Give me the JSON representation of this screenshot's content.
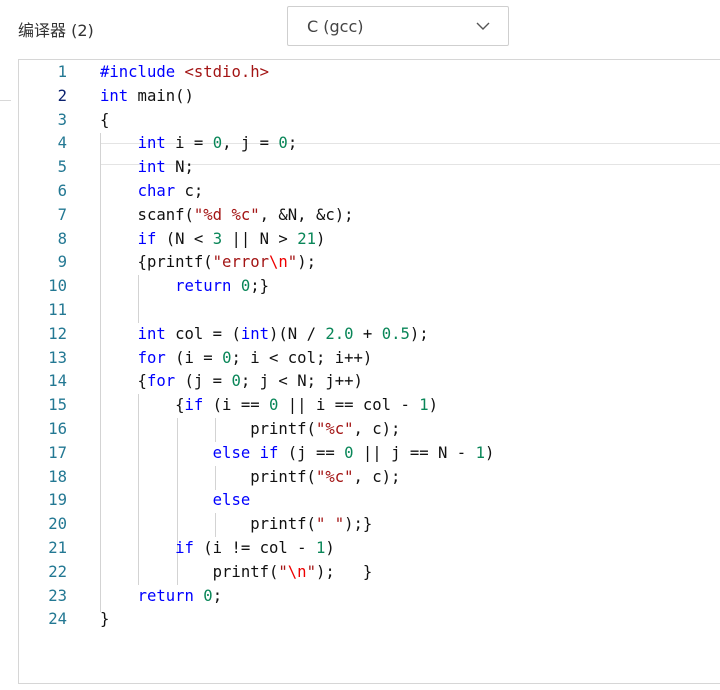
{
  "header": {
    "compiler_label": "编译器 (2)",
    "compiler_select": {
      "value": "C (gcc)"
    }
  },
  "icons": {
    "dropdown": "chevron-down-icon"
  },
  "colors": {
    "keyword": "#0000ff",
    "string": "#a31515",
    "number": "#098658",
    "escape": "#ee0000",
    "line_number": "#237893"
  },
  "editor": {
    "active_line": 2,
    "lines": [
      {
        "n": "1",
        "tokens": [
          {
            "t": "#include ",
            "c": "k"
          },
          {
            "t": "<stdio.h>",
            "c": "s"
          }
        ]
      },
      {
        "n": "2",
        "tokens": [
          {
            "t": "int",
            "c": "k"
          },
          {
            "t": " main()",
            "c": ""
          }
        ]
      },
      {
        "n": "3",
        "tokens": [
          {
            "t": "{",
            "c": ""
          }
        ]
      },
      {
        "n": "4",
        "tokens": [
          {
            "t": "    ",
            "c": ""
          },
          {
            "t": "int",
            "c": "k"
          },
          {
            "t": " i = ",
            "c": ""
          },
          {
            "t": "0",
            "c": "n"
          },
          {
            "t": ", j = ",
            "c": ""
          },
          {
            "t": "0",
            "c": "n"
          },
          {
            "t": ";",
            "c": ""
          }
        ]
      },
      {
        "n": "5",
        "tokens": [
          {
            "t": "    ",
            "c": ""
          },
          {
            "t": "int",
            "c": "k"
          },
          {
            "t": " N;",
            "c": ""
          }
        ]
      },
      {
        "n": "6",
        "tokens": [
          {
            "t": "    ",
            "c": ""
          },
          {
            "t": "char",
            "c": "k"
          },
          {
            "t": " c;",
            "c": ""
          }
        ]
      },
      {
        "n": "7",
        "tokens": [
          {
            "t": "    scanf(",
            "c": ""
          },
          {
            "t": "\"%d %c\"",
            "c": "s"
          },
          {
            "t": ", &N, &c);",
            "c": ""
          }
        ]
      },
      {
        "n": "8",
        "tokens": [
          {
            "t": "    ",
            "c": ""
          },
          {
            "t": "if",
            "c": "k"
          },
          {
            "t": " (N < ",
            "c": ""
          },
          {
            "t": "3",
            "c": "n"
          },
          {
            "t": " || N > ",
            "c": ""
          },
          {
            "t": "21",
            "c": "n"
          },
          {
            "t": ")",
            "c": ""
          }
        ]
      },
      {
        "n": "9",
        "tokens": [
          {
            "t": "    {printf(",
            "c": ""
          },
          {
            "t": "\"error",
            "c": "s"
          },
          {
            "t": "\\n",
            "c": "e"
          },
          {
            "t": "\"",
            "c": "s"
          },
          {
            "t": ");",
            "c": ""
          }
        ]
      },
      {
        "n": "10",
        "tokens": [
          {
            "t": "        ",
            "c": ""
          },
          {
            "t": "return",
            "c": "k"
          },
          {
            "t": " ",
            "c": ""
          },
          {
            "t": "0",
            "c": "n"
          },
          {
            "t": ";}",
            "c": ""
          }
        ]
      },
      {
        "n": "11",
        "tokens": []
      },
      {
        "n": "12",
        "tokens": [
          {
            "t": "    ",
            "c": ""
          },
          {
            "t": "int",
            "c": "k"
          },
          {
            "t": " col = (",
            "c": ""
          },
          {
            "t": "int",
            "c": "k"
          },
          {
            "t": ")(N / ",
            "c": ""
          },
          {
            "t": "2.0",
            "c": "n"
          },
          {
            "t": " + ",
            "c": ""
          },
          {
            "t": "0.5",
            "c": "n"
          },
          {
            "t": ");",
            "c": ""
          }
        ]
      },
      {
        "n": "13",
        "tokens": [
          {
            "t": "    ",
            "c": ""
          },
          {
            "t": "for",
            "c": "k"
          },
          {
            "t": " (i = ",
            "c": ""
          },
          {
            "t": "0",
            "c": "n"
          },
          {
            "t": "; i < col; i++)",
            "c": ""
          }
        ]
      },
      {
        "n": "14",
        "tokens": [
          {
            "t": "    {",
            "c": ""
          },
          {
            "t": "for",
            "c": "k"
          },
          {
            "t": " (j = ",
            "c": ""
          },
          {
            "t": "0",
            "c": "n"
          },
          {
            "t": "; j < N; j++)",
            "c": ""
          }
        ]
      },
      {
        "n": "15",
        "tokens": [
          {
            "t": "        {",
            "c": ""
          },
          {
            "t": "if",
            "c": "k"
          },
          {
            "t": " (i == ",
            "c": ""
          },
          {
            "t": "0",
            "c": "n"
          },
          {
            "t": " || i == col - ",
            "c": ""
          },
          {
            "t": "1",
            "c": "n"
          },
          {
            "t": ")",
            "c": ""
          }
        ]
      },
      {
        "n": "16",
        "tokens": [
          {
            "t": "                printf(",
            "c": ""
          },
          {
            "t": "\"%c\"",
            "c": "s"
          },
          {
            "t": ", c);",
            "c": ""
          }
        ]
      },
      {
        "n": "17",
        "tokens": [
          {
            "t": "            ",
            "c": ""
          },
          {
            "t": "else",
            "c": "k"
          },
          {
            "t": " ",
            "c": ""
          },
          {
            "t": "if",
            "c": "k"
          },
          {
            "t": " (j == ",
            "c": ""
          },
          {
            "t": "0",
            "c": "n"
          },
          {
            "t": " || j == N - ",
            "c": ""
          },
          {
            "t": "1",
            "c": "n"
          },
          {
            "t": ")",
            "c": ""
          }
        ]
      },
      {
        "n": "18",
        "tokens": [
          {
            "t": "                printf(",
            "c": ""
          },
          {
            "t": "\"%c\"",
            "c": "s"
          },
          {
            "t": ", c);",
            "c": ""
          }
        ]
      },
      {
        "n": "19",
        "tokens": [
          {
            "t": "            ",
            "c": ""
          },
          {
            "t": "else",
            "c": "k"
          }
        ]
      },
      {
        "n": "20",
        "tokens": [
          {
            "t": "                printf(",
            "c": ""
          },
          {
            "t": "\" \"",
            "c": "s"
          },
          {
            "t": ");}",
            "c": ""
          }
        ]
      },
      {
        "n": "21",
        "tokens": [
          {
            "t": "        ",
            "c": ""
          },
          {
            "t": "if",
            "c": "k"
          },
          {
            "t": " (i != col - ",
            "c": ""
          },
          {
            "t": "1",
            "c": "n"
          },
          {
            "t": ")",
            "c": ""
          }
        ]
      },
      {
        "n": "22",
        "tokens": [
          {
            "t": "            printf(",
            "c": ""
          },
          {
            "t": "\"",
            "c": "s"
          },
          {
            "t": "\\n",
            "c": "e"
          },
          {
            "t": "\"",
            "c": "s"
          },
          {
            "t": ");   }",
            "c": ""
          }
        ]
      },
      {
        "n": "23",
        "tokens": [
          {
            "t": "    ",
            "c": ""
          },
          {
            "t": "return",
            "c": "k"
          },
          {
            "t": " ",
            "c": ""
          },
          {
            "t": "0",
            "c": "n"
          },
          {
            "t": ";",
            "c": ""
          }
        ]
      },
      {
        "n": "24",
        "tokens": [
          {
            "t": "}",
            "c": ""
          }
        ]
      }
    ]
  }
}
